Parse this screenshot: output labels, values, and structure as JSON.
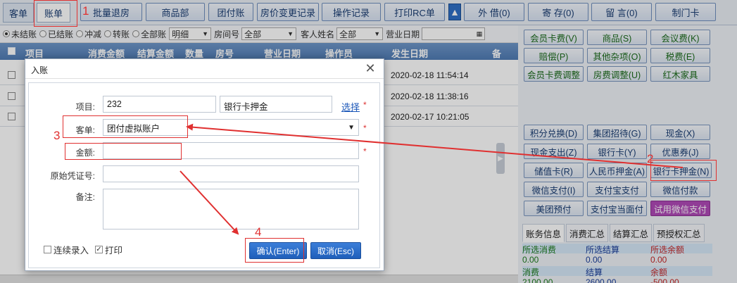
{
  "tabs": [
    "客单",
    "账单"
  ],
  "top_buttons": [
    "批量退房",
    "商品部",
    "团付账",
    "房价变更记录",
    "操作记录",
    "打印RC单",
    "外 借(0)",
    "寄 存(0)",
    "留 言(0)",
    "制门卡"
  ],
  "filter": {
    "radios": [
      "未结账",
      "已结账",
      "冲减",
      "转账",
      "全部账"
    ],
    "detail": "明细",
    "room_label": "房间号",
    "room_value": "全部",
    "guest_label": "客人姓名",
    "guest_value": "全部",
    "date_label": "营业日期"
  },
  "grid": {
    "columns": [
      "项目",
      "消费金额",
      "结算金额",
      "数量",
      "房号",
      "营业日期",
      "操作员",
      "发生日期",
      "备"
    ],
    "rows": [
      {
        "date": "2020-02-18 11:54:14"
      },
      {
        "date": "2020-02-18 11:38:16"
      },
      {
        "date": "2020-02-17 10:21:05"
      }
    ]
  },
  "right_buttons_top": [
    "会员卡费(V)",
    "商品(S)",
    "会议费(K)",
    "赔偿(P)",
    "其他杂项(O)",
    "税费(E)",
    "会员卡费调整",
    "房费调整(U)",
    "红木家具"
  ],
  "right_buttons_pay": [
    "积分兑换(D)",
    "集团招待(G)",
    "现金(X)",
    "现金支出(Z)",
    "银行卡(Y)",
    "优惠券(J)",
    "储值卡(R)",
    "人民币押金(A)",
    "银行卡押金(N)",
    "微信支付(I)",
    "支付宝支付",
    "微信付款",
    "美团预付",
    "支付宝当面付",
    "试用微信支付"
  ],
  "summary": {
    "tabs": [
      "账务信息",
      "消费汇总",
      "结算汇总",
      "预授权汇总"
    ],
    "row1": [
      "所选消费",
      "所选结算",
      "所选余额"
    ],
    "row2": [
      "0.00",
      "0.00",
      "0.00"
    ],
    "row3": [
      "消费",
      "结算",
      "余额"
    ],
    "row4": [
      "2100.00",
      "2600.00",
      "-500.00"
    ]
  },
  "dialog": {
    "title": "入账",
    "item_label": "项目:",
    "item_code": "232",
    "item_name": "银行卡押金",
    "choose_link": "选择",
    "guest_label": "客单:",
    "guest_value": "团付虚拟账户",
    "amount_label": "金额:",
    "amount_value": "",
    "voucher_label": "原始凭证号:",
    "voucher_value": "",
    "note_label": "备注:",
    "note_value": "",
    "continuous_label": "连续录入",
    "print_label": "打印",
    "ok_label": "确认(Enter)",
    "cancel_label": "取消(Esc)"
  },
  "annotations": [
    "1",
    "2",
    "3",
    "4"
  ],
  "colors": {
    "accent": "#2f6fc6",
    "annotation": "#e03030",
    "header": "#5a86bd"
  }
}
